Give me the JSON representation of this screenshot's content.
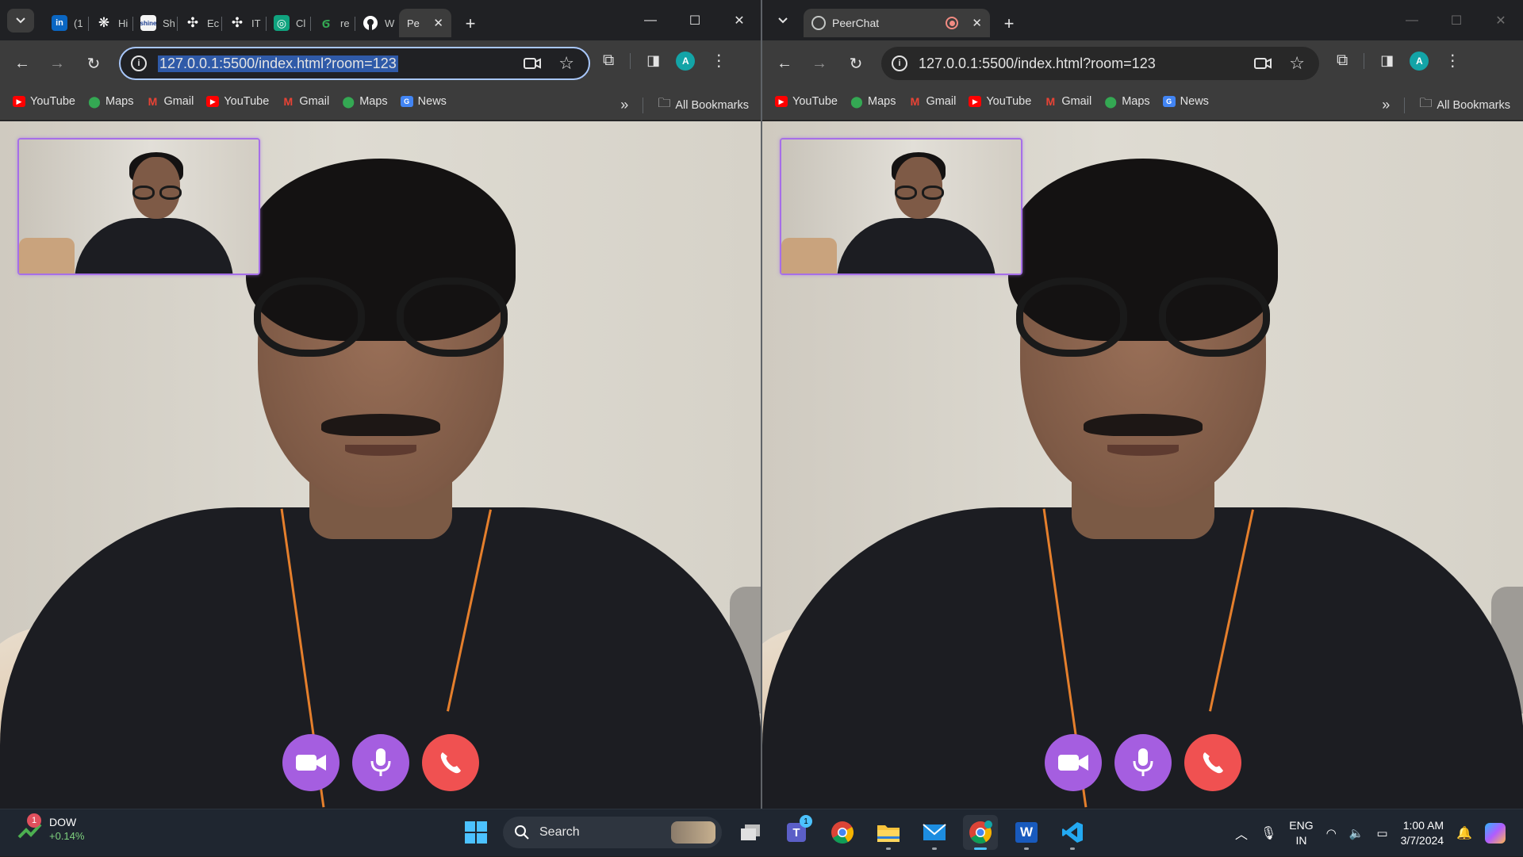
{
  "left_window": {
    "tabs": [
      {
        "title": "(1",
        "icon": "linkedin-icon",
        "color": "#0a66c2",
        "glyph": "in"
      },
      {
        "title": "Hi",
        "icon": "openai-icon",
        "color": "#ffffff",
        "glyph": "❋"
      },
      {
        "title": "Sh",
        "icon": "shine-icon",
        "color": "#f5f5f5",
        "glyph": "▤"
      },
      {
        "title": "Ec",
        "icon": "fan-icon",
        "color": "#ffffff",
        "glyph": "✣"
      },
      {
        "title": "IT",
        "icon": "fan-icon",
        "color": "#ffffff",
        "glyph": "✣"
      },
      {
        "title": "Cl",
        "icon": "chatgpt-icon",
        "color": "#10a37f",
        "glyph": "◎"
      },
      {
        "title": "re",
        "icon": "leaf-icon",
        "color": "#34a853",
        "glyph": "ϭ"
      },
      {
        "title": "W",
        "icon": "github-icon",
        "color": "#ffffff",
        "glyph": "●"
      },
      {
        "title": "Pe",
        "icon": "peerchat-icon",
        "active": true
      }
    ],
    "close_glyph": "✕",
    "new_tab_glyph": "+",
    "url": "127.0.0.1:5500/index.html?room=123",
    "window_controls": [
      "—",
      "☐",
      "✕"
    ]
  },
  "right_window": {
    "tab_title": "PeerChat",
    "close_glyph": "✕",
    "new_tab_glyph": "+",
    "url": "127.0.0.1:5500/index.html?room=123",
    "window_controls": [
      "—",
      "☐",
      "✕"
    ]
  },
  "bookmarks": [
    {
      "label": "YouTube",
      "icon": "youtube-icon",
      "color": "#ff0000"
    },
    {
      "label": "Maps",
      "icon": "maps-icon",
      "color": "#34a853"
    },
    {
      "label": "Gmail",
      "icon": "gmail-icon",
      "color": "#ea4335"
    },
    {
      "label": "YouTube",
      "icon": "youtube-icon",
      "color": "#ff0000"
    },
    {
      "label": "Gmail",
      "icon": "gmail-icon",
      "color": "#ea4335"
    },
    {
      "label": "Maps",
      "icon": "maps-icon",
      "color": "#34a853"
    },
    {
      "label": "News",
      "icon": "news-icon",
      "color": "#4285f4"
    }
  ],
  "all_bookmarks_label": "All Bookmarks",
  "more_glyph": "»",
  "profile_initial": "A",
  "taskbar": {
    "widget_badge": "1",
    "widget_title": "DOW",
    "widget_change": "+0.14%",
    "search_label": "Search",
    "teams_badge": "1",
    "lang_line1": "ENG",
    "lang_line2": "IN",
    "time": "1:00 AM",
    "date": "3/7/2024"
  },
  "colors": {
    "accent_purple": "#a55ee0",
    "hangup_red": "#f05151",
    "pip_border": "#a66fe8"
  }
}
